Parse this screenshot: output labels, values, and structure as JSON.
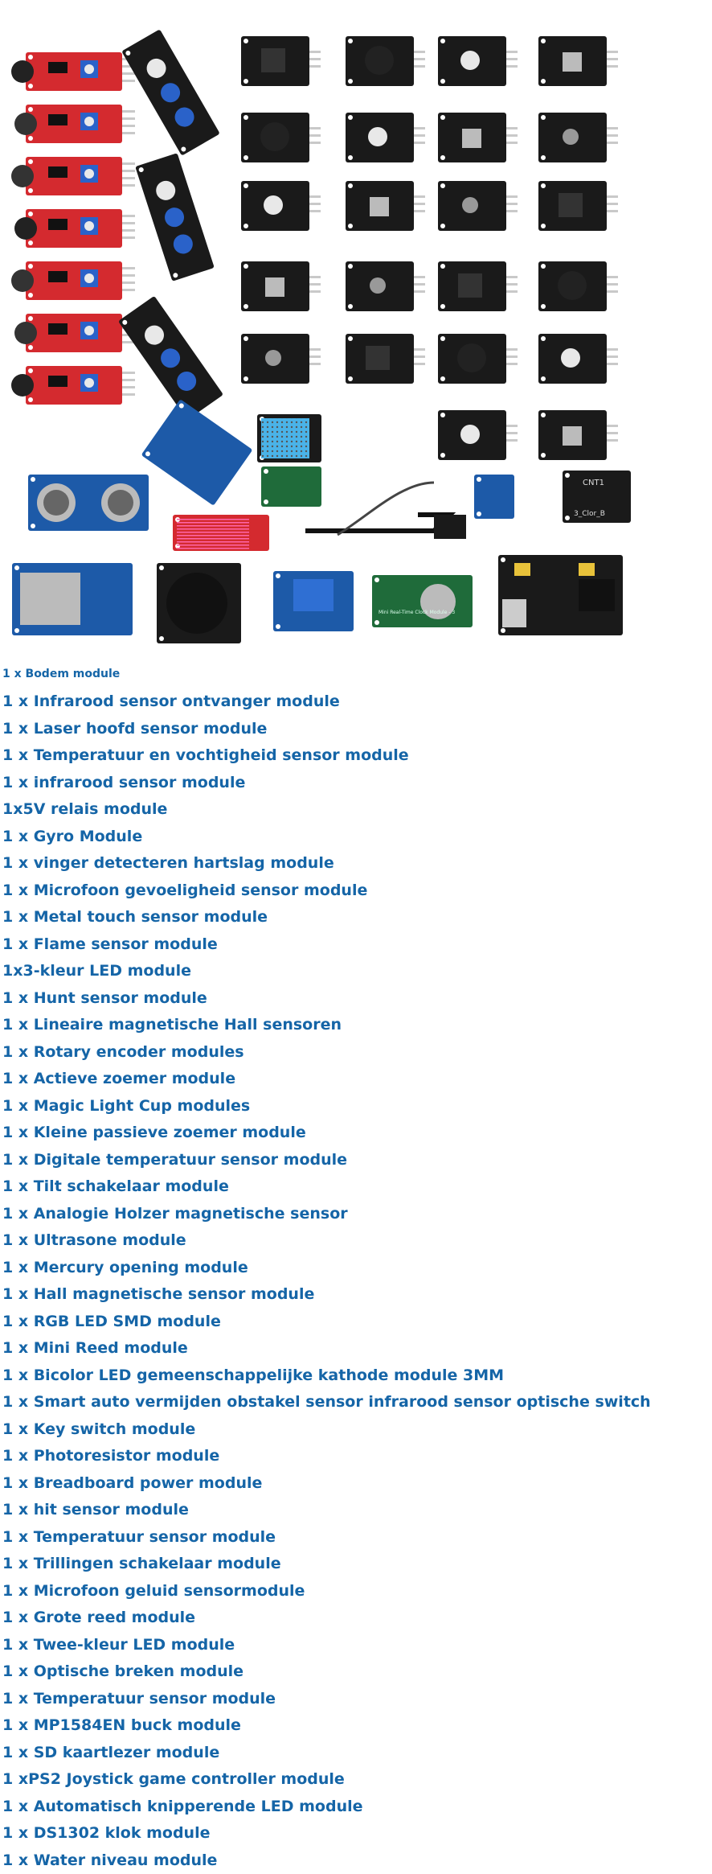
{
  "image": {
    "board_labels": [
      "CNT1",
      "3_Clor_B",
      "Mini Real-Time Clock Module - 3"
    ]
  },
  "colors": {
    "link_text": "#1565a7",
    "red_pcb": "#d42a2f",
    "black_pcb": "#1a1a1a",
    "blue_pcb": "#1d5aa8",
    "green_pcb": "#1f6b3a"
  },
  "modules": [
    "1 x Bodem module",
    "1 x Infrarood sensor ontvanger module",
    "1 x Laser hoofd sensor module",
    "1 x Temperatuur en vochtigheid sensor module",
    "1 x infrarood sensor module",
    "1x5V relais module",
    "1 x Gyro Module",
    "1 x vinger detecteren hartslag module",
    "1 x Microfoon gevoeligheid sensor module",
    "1 x Metal touch sensor module",
    "1 x Flame sensor module",
    "1x3-kleur LED module",
    "1 x Hunt sensor module",
    "1 x Lineaire magnetische Hall sensoren",
    "1 x Rotary encoder modules",
    "1 x Actieve zoemer module",
    "1 x Magic Light Cup modules",
    "1 x Kleine passieve zoemer module",
    "1 x Digitale temperatuur sensor module",
    "1 x Tilt schakelaar module",
    "1 x Analogie Holzer magnetische sensor",
    "1 x Ultrasone module",
    "1 x Mercury opening module",
    "1 x Hall magnetische sensor module",
    "1 x RGB LED SMD module",
    "1 x Mini Reed module",
    "1 x Bicolor LED gemeenschappelijke kathode module 3MM",
    "1 x Smart auto vermijden obstakel sensor infrarood sensor optische switch",
    "1 x Key switch module",
    "1 x Photoresistor module",
    "1 x Breadboard power module",
    "1 x hit sensor module",
    "1 x Temperatuur sensor module",
    "1 x Trillingen schakelaar module",
    "1 x Microfoon geluid sensormodule",
    "1 x Grote reed module",
    "1 x Twee-kleur LED module",
    "1 x Optische breken module",
    "1 x Temperatuur sensor module",
    "1 x MP1584EN buck module",
    "1 x SD kaartlezer module",
    "1 xPS2 Joystick game controller module",
    "1 x Automatisch knipperende LED module",
    "1 x DS1302 klok module",
    "1 x Water niveau module"
  ]
}
